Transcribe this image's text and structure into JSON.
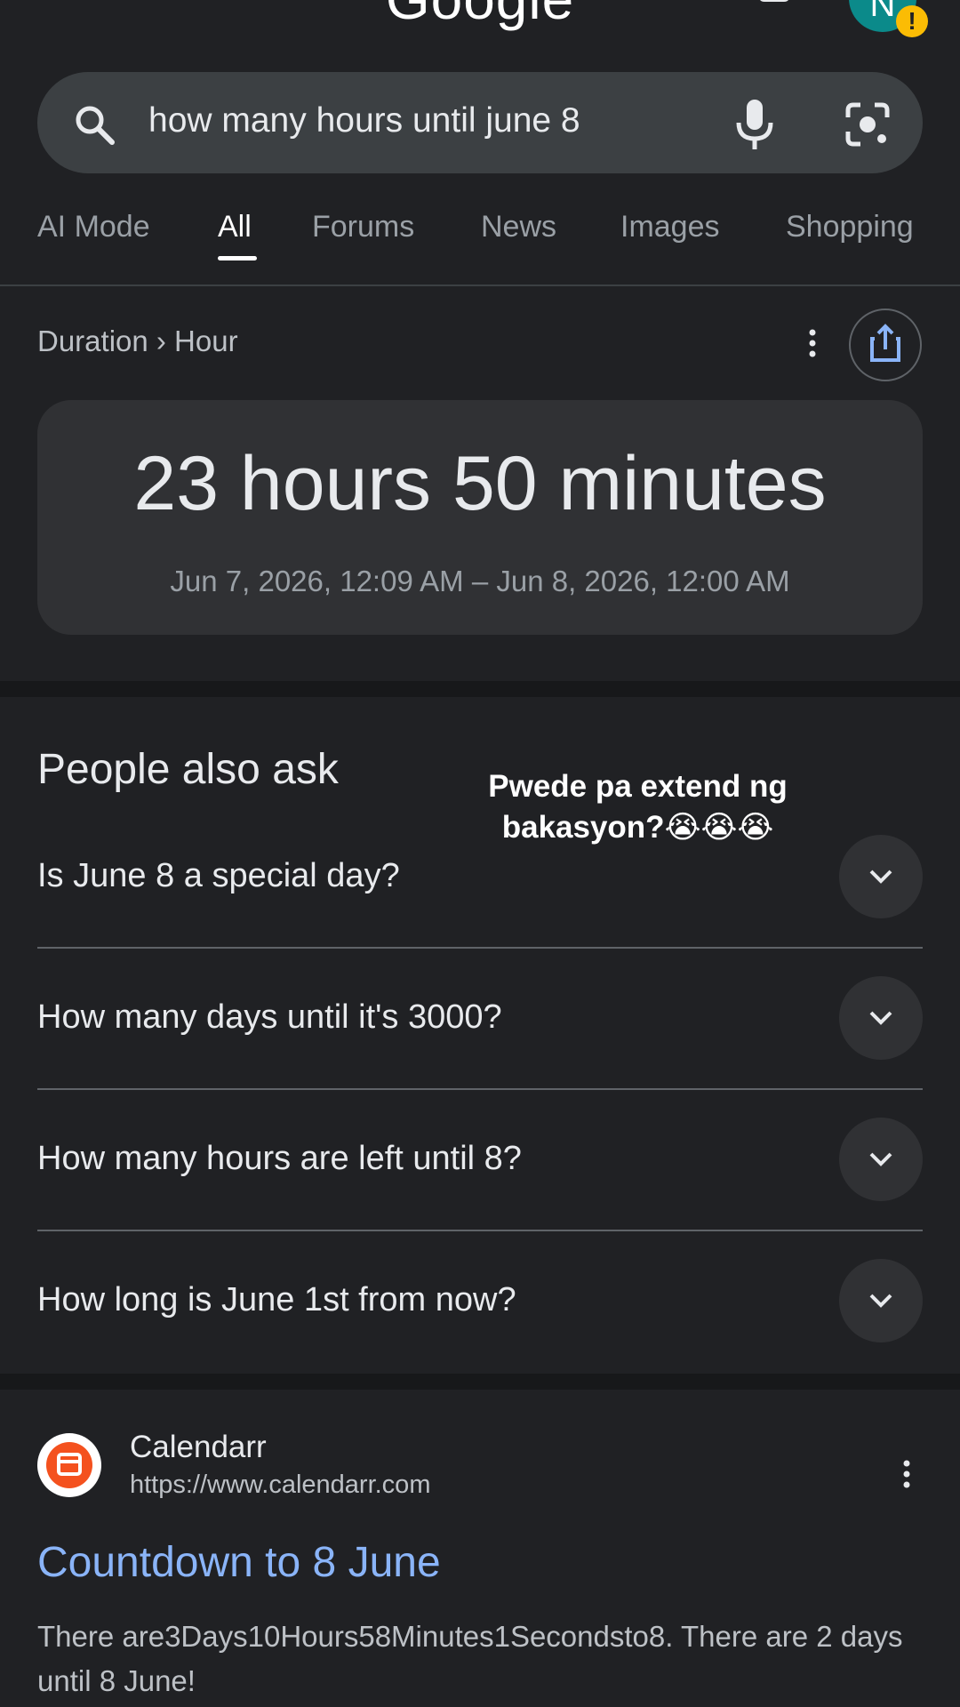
{
  "header": {
    "logo": "Google",
    "avatar_initial": "N",
    "badge": "!"
  },
  "search": {
    "query": "how many hours until june 8"
  },
  "tabs": [
    {
      "label": "AI Mode",
      "active": false
    },
    {
      "label": "All",
      "active": true
    },
    {
      "label": "Forums",
      "active": false
    },
    {
      "label": "News",
      "active": false
    },
    {
      "label": "Images",
      "active": false
    },
    {
      "label": "Shopping",
      "active": false
    }
  ],
  "duration_card": {
    "breadcrumb": "Duration › Hour",
    "value": "23 hours 50 minutes",
    "range": "Jun 7, 2026, 12:09 AM – Jun 8, 2026, 12:00 AM"
  },
  "people_also_ask": {
    "title": "People also ask",
    "questions": [
      "Is June 8 a special day?",
      "How many days until it's 3000?",
      "How many hours are left until 8?",
      "How long is June 1st from now?"
    ]
  },
  "overlay_caption": {
    "line1": "Pwede pa extend ng",
    "line2": "bakasyon?😭😭😭"
  },
  "result": {
    "site_name": "Calendarr",
    "url": "https://www.calendarr.com",
    "title": "Countdown to 8 June",
    "snippet": "There are3Days10Hours58Minutes1Secondsto8. There are 2 days until 8 June!"
  },
  "colors": {
    "background": "#202124",
    "surface": "#303134",
    "link": "#8ab4f8",
    "badge": "#fbbc04",
    "avatar": "#0b8a8a",
    "site_icon": "#f4511e"
  }
}
